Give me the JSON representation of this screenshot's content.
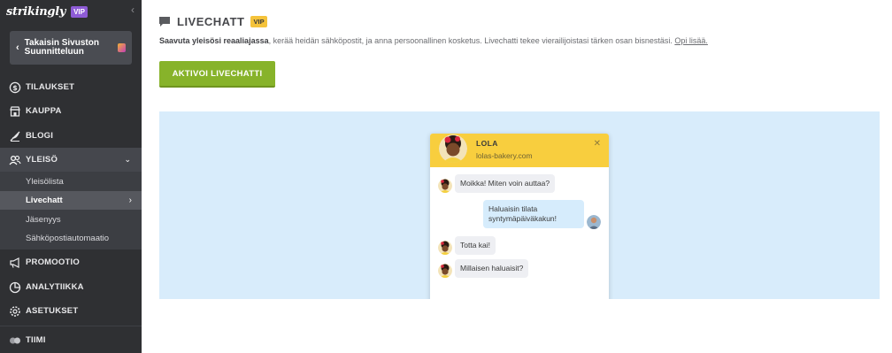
{
  "brand": {
    "logo": "strikingly",
    "vip": "VIP",
    "collapse": "‹"
  },
  "back": {
    "label": "Takaisin Sivuston\nSuunnitteluun"
  },
  "nav": {
    "orders": "TILAUKSET",
    "store": "KAUPPA",
    "blog": "BLOGI",
    "audience": "YLEISÖ",
    "audience_sub": [
      "Yleisölista",
      "Livechatt",
      "Jäsenyys",
      "Sähköpostiautomaatio"
    ],
    "promotion": "PROMOOTIO",
    "analytics": "ANALYTIIKKA",
    "settings": "ASETUKSET",
    "team": "TIIMI"
  },
  "main": {
    "title": "LIVECHATT",
    "vip": "VIP",
    "desc_bold": "Saavuta yleisösi reaaliajassa",
    "desc_rest": ", kerää heidän sähköpostit, ja anna persoonallinen kosketus. Livechatti tekee vierailijoistasi tärken osan bisnestäsi. ",
    "learn_more": "Opi lisää.",
    "activate": "AKTIVOI LIVECHATTI"
  },
  "chat": {
    "agent_name": "LOLA",
    "domain": "lolas-bakery.com",
    "close": "✕",
    "messages": [
      "Moikka! Miten voin auttaa?",
      "Haluaisin tilata syntymäpäiväkakun!",
      "Totta kai!",
      "Millaisen haluaisit?"
    ]
  },
  "colors": {
    "sidebar": "#2f3033",
    "accent_green": "#87b32a",
    "vip_purple": "#8e5bd6",
    "vip_yellow": "#f5c33b",
    "preview_bg": "#d8ecfb",
    "chat_header": "#f8ce3e"
  }
}
